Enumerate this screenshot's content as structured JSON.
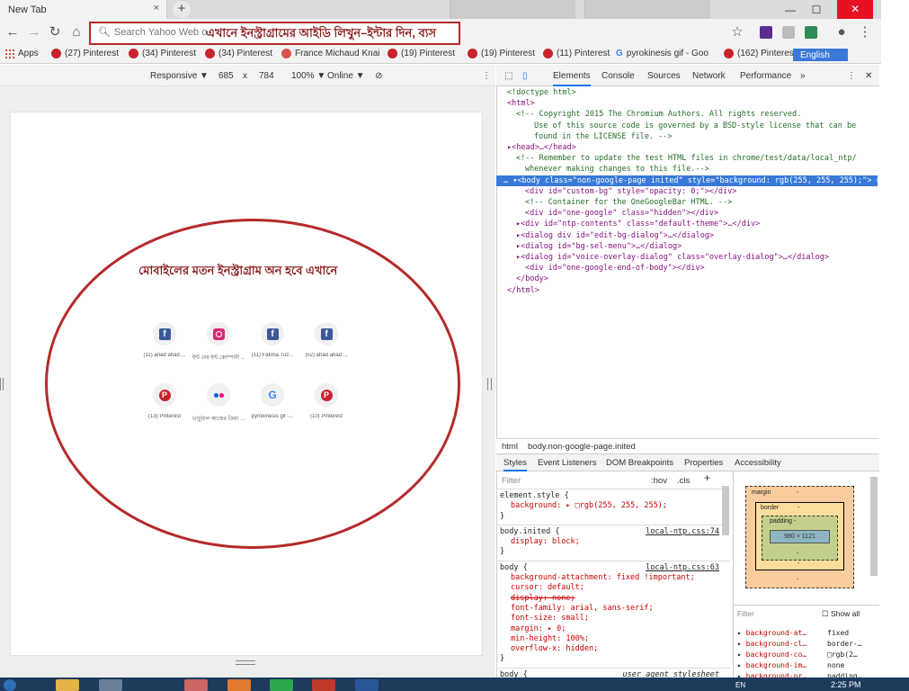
{
  "browser": {
    "tab_title": "New Tab",
    "tab_close": "×",
    "new_tab": "+",
    "window_controls": {
      "minimize": "—",
      "maximize": "☐",
      "close": "✕"
    }
  },
  "omnibox": {
    "placeholder": "Search Yahoo Web o",
    "annotation": "এখানে ইনস্ট্রাগ্রামের আইডি লিখুন–ইন্টার দিন, ব্যস"
  },
  "bookmarks": [
    {
      "label": "Apps",
      "icon": "apps-grid-icon"
    },
    {
      "label": "(27) Pinterest",
      "icon": "pinterest-icon"
    },
    {
      "label": "(34) Pinterest",
      "icon": "pinterest-icon"
    },
    {
      "label": "(34) Pinterest",
      "icon": "pinterest-icon"
    },
    {
      "label": "France Michaud Knai",
      "icon": "site-icon"
    },
    {
      "label": "(19) Pinterest",
      "icon": "pinterest-icon"
    },
    {
      "label": "(19) Pinterest",
      "icon": "pinterest-icon"
    },
    {
      "label": "(11) Pinterest",
      "icon": "pinterest-icon"
    },
    {
      "label": "pyrokinesis gif - Goo",
      "icon": "google-icon"
    },
    {
      "label": "(162) Pinterest",
      "icon": "pinterest-icon"
    },
    {
      "label": "English",
      "icon": "translate-icon"
    }
  ],
  "device_toolbar": {
    "device": "Responsive ▼",
    "width": "685",
    "times": "x",
    "height": "784",
    "zoom": "100% ▼",
    "network": "Online ▼"
  },
  "page": {
    "caption": "মোবাইলের মতন ইনস্ট্রাগ্রাম অন হবে এখানে",
    "tiles": [
      {
        "label": "(11) ahad ahad ...",
        "icon": "facebook-icon"
      },
      {
        "label": "ইন্ট নেম ইন্ট কোম্পানী ...",
        "icon": "instagram-icon"
      },
      {
        "label": "(11) Fatima Tuz...",
        "icon": "facebook-icon"
      },
      {
        "label": "(52) ahad ahad ...",
        "icon": "facebook-icon"
      },
      {
        "label": "(13) Pinterest",
        "icon": "pinterest-icon"
      },
      {
        "label": "ভার্চুয়াল কাজের ক্রিয়া ...",
        "icon": "flickr-icon"
      },
      {
        "label": "pyrokinesis gif -...",
        "icon": "google-icon"
      },
      {
        "label": "(10) Pinterest",
        "icon": "pinterest-icon"
      }
    ]
  },
  "devtools": {
    "tabs": [
      "Elements",
      "Console",
      "Sources",
      "Network",
      "Performance",
      "»"
    ],
    "dom_lines": [
      {
        "indent": 0,
        "text": "<!doctype html>",
        "kind": "cm"
      },
      {
        "indent": 0,
        "text": "<html>",
        "kind": "tg"
      },
      {
        "indent": 1,
        "text": "<!-- Copyright 2015 The Chromium Authors. All rights reserved.",
        "kind": "cm"
      },
      {
        "indent": 3,
        "text": "Use of this source code is governed by a BSD-style license that can be",
        "kind": "cm"
      },
      {
        "indent": 3,
        "text": "found in the LICENSE file. -->",
        "kind": "cm"
      },
      {
        "indent": 0,
        "text": "▸<head>…</head>",
        "kind": "tg"
      },
      {
        "indent": 1,
        "text": "<!-- Remember to update the test HTML files in chrome/test/data/local_ntp/",
        "kind": "cm"
      },
      {
        "indent": 2,
        "text": "whenever making changes to this file.-->",
        "kind": "cm"
      },
      {
        "indent": 0,
        "text": "… ▾<body class=\"non-google-page inited\" style=\"background: rgb(255, 255, 255);\"> == $0",
        "kind": "sel"
      },
      {
        "indent": 2,
        "text": "<div id=\"custom-bg\" style=\"opacity: 0;\"></div>",
        "kind": "tg"
      },
      {
        "indent": 2,
        "text": "<!-- Container for the OneGoogleBar HTML. -->",
        "kind": "cm"
      },
      {
        "indent": 2,
        "text": "<div id=\"one-google\" class=\"hidden\"></div>",
        "kind": "tg"
      },
      {
        "indent": 1,
        "text": "▸<div id=\"ntp-contents\" class=\"default-theme\">…</div>",
        "kind": "tg"
      },
      {
        "indent": 1,
        "text": "▸<dialog div id=\"edit-bg-dialog\">…</dialog>",
        "kind": "tg"
      },
      {
        "indent": 1,
        "text": "▸<dialog id=\"bg-sel-menu\">…</dialog>",
        "kind": "tg"
      },
      {
        "indent": 1,
        "text": "▸<dialog id=\"voice-overlay-dialog\" class=\"overlay-dialog\">…</dialog>",
        "kind": "tg"
      },
      {
        "indent": 2,
        "text": "<div id=\"one-google-end-of-body\"></div>",
        "kind": "tg"
      },
      {
        "indent": 1,
        "text": "</body>",
        "kind": "tg"
      },
      {
        "indent": 0,
        "text": "</html>",
        "kind": "tg"
      }
    ],
    "breadcrumbs": [
      "html",
      "body.non-google-page.inited"
    ],
    "subtabs": [
      "Styles",
      "Event Listeners",
      "DOM Breakpoints",
      "Properties",
      "Accessibility"
    ],
    "styles_filter": "Filter",
    "hov": ":hov",
    "cls": ".cls",
    "plus": "+",
    "rules": [
      {
        "selector": "element.style {",
        "source": "",
        "props": [
          {
            "t": "background: ▸ □rgb(255, 255, 255);",
            "strike": false
          }
        ]
      },
      {
        "selector": "body.inited {",
        "source": "local-ntp.css:74",
        "props": [
          {
            "t": "display: block;",
            "strike": false
          }
        ]
      },
      {
        "selector": "body {",
        "source": "local-ntp.css:63",
        "props": [
          {
            "t": "background-attachment: fixed !important;",
            "strike": false
          },
          {
            "t": "cursor: default;",
            "strike": false
          },
          {
            "t": "display: none;",
            "strike": true
          },
          {
            "t": "font-family: arial, sans-serif;",
            "strike": false
          },
          {
            "t": "font-size: small;",
            "strike": false
          },
          {
            "t": "margin: ▸ 0;",
            "strike": false
          },
          {
            "t": "min-height: 100%;",
            "strike": false
          },
          {
            "t": "overflow-x: hidden;",
            "strike": false
          }
        ]
      },
      {
        "selector": "body {",
        "source": "user agent stylesheet",
        "props": []
      }
    ],
    "box_model": {
      "margin": "margin",
      "margin_val": "-",
      "border": "border",
      "border_val": "-",
      "padding": "padding -",
      "content": "980 × 1121",
      "dash": "-"
    },
    "computed_filter": "Filter",
    "show_all": "Show all",
    "computed": [
      {
        "name": "background-at…",
        "value": "fixed"
      },
      {
        "name": "background-cl…",
        "value": "border-…"
      },
      {
        "name": "background-co…",
        "value": "□rgb(2…"
      },
      {
        "name": "background-im…",
        "value": "none"
      },
      {
        "name": "background-or…",
        "value": "padding…"
      }
    ]
  },
  "taskbar": {
    "time": "2:25 PM",
    "lang": "EN"
  }
}
